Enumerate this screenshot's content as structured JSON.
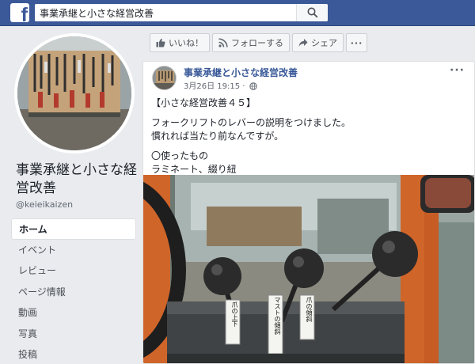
{
  "topbar": {
    "logo": "f",
    "search_value": "事業承継と小さな経営改善",
    "search_icon": "search-icon"
  },
  "page": {
    "name": "事業承継と小さな経営改善",
    "handle": "@keieikaizen"
  },
  "nav": {
    "items": [
      {
        "label": "ホーム",
        "active": true
      },
      {
        "label": "イベント"
      },
      {
        "label": "レビュー"
      },
      {
        "label": "ページ情報"
      },
      {
        "label": "動画"
      },
      {
        "label": "写真"
      },
      {
        "label": "投稿"
      }
    ]
  },
  "actions": {
    "like": "いいね！",
    "follow": "フォローする",
    "share": "シェア",
    "more": "···"
  },
  "post": {
    "author": "事業承継と小さな経営改善",
    "time": "3月26日 19:15 ·",
    "menu": "···",
    "lines": [
      "【小さな経営改善４５】",
      "フォークリフトのレバーの説明をつけました。",
      "慣れれば当たり前なんですが。",
      "〇使ったもの",
      "ラミネート、綴り紐"
    ],
    "photo_labels": [
      "爪の上下",
      "マストの傾斜",
      "爪の傾斜"
    ]
  },
  "colors": {
    "brand": "#3b5998",
    "link": "#385898",
    "background": "#e9ebee"
  }
}
